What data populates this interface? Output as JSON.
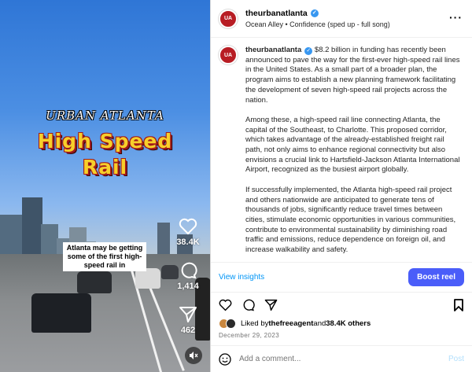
{
  "media": {
    "overlay_subtitle": "URBAN ATLANTA",
    "overlay_title_line1": "High Speed",
    "overlay_title_line2": "Rail",
    "caption": "Atlanta may be getting some of the first high-speed rail in",
    "likes_count": "38.4K",
    "comments_count": "1,414",
    "shares_count": "462"
  },
  "header": {
    "username": "theurbanatlanta",
    "audio": "Ocean Alley • Confidence (sped up - full song)"
  },
  "post": {
    "username": "theurbanatlanta",
    "paragraphs": [
      "$8.2 billion in funding has recently been announced to pave the way for the first-ever high-speed rail lines in the United States. As a small part of a broader plan, the program aims to establish a new planning framework facilitating the development of seven high-speed rail projects across the nation.",
      "Among these, a high-speed rail line connecting Atlanta, the capital of the Southeast, to Charlotte. This proposed corridor, which takes advantage of the already-established freight rail path, not only aims to enhance regional connectivity but also envisions a crucial link to Hartsfield-Jackson Atlanta International Airport, recognized as the busiest airport globally.",
      "If successfully implemented, the Atlanta high-speed rail project and others nationwide are anticipated to generate tens of thousands of jobs, significantly reduce travel times between cities, stimulate economic opportunities in various communities, contribute to environmental sustainability by diminishing road traffic and emissions, reduce dependence on foreign oil, and increase walkability and safety."
    ]
  },
  "insights": {
    "view_label": "View insights",
    "boost_label": "Boost reel"
  },
  "likes": {
    "prefix": "Liked by ",
    "user": "thefreeagent",
    "middle": " and ",
    "others": "38.4K others"
  },
  "date": "December 29, 2023",
  "comment": {
    "placeholder": "Add a comment...",
    "post_label": "Post"
  },
  "colors": {
    "accent": "#0095f6",
    "boost": "#4a5df9",
    "title_yellow": "#f7cf2a",
    "title_red": "#a0191b"
  }
}
